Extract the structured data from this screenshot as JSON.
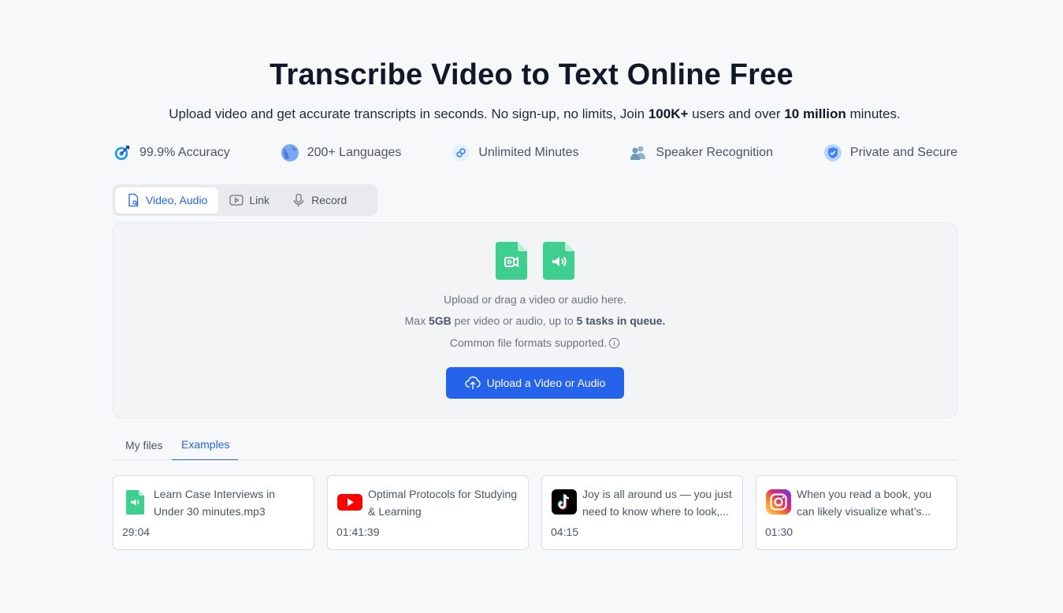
{
  "header": {
    "title": "Transcribe Video to Text Online Free",
    "subtitle_pre": "Upload video and get accurate transcripts in seconds. No sign-up, no limits, Join ",
    "subtitle_b1": "100K+",
    "subtitle_mid": " users and over ",
    "subtitle_b2": "10 million",
    "subtitle_post": " minutes."
  },
  "features": [
    {
      "label": "99.9% Accuracy",
      "icon": "target-icon"
    },
    {
      "label": "200+ Languages",
      "icon": "globe-icon"
    },
    {
      "label": "Unlimited Minutes",
      "icon": "infinity-icon"
    },
    {
      "label": "Speaker Recognition",
      "icon": "users-icon"
    },
    {
      "label": "Private and Secure",
      "icon": "shield-icon"
    }
  ],
  "source_tabs": [
    {
      "label": "Video, Audio",
      "icon": "file-icon",
      "active": true
    },
    {
      "label": "Link",
      "icon": "play-icon",
      "active": false
    },
    {
      "label": "Record",
      "icon": "microphone-icon",
      "active": false
    }
  ],
  "dropzone": {
    "line1": "Upload or drag a video or audio here.",
    "line2_a": "Max ",
    "line2_b": "5GB",
    "line2_c": " per video or audio, up to ",
    "line2_d": "5 tasks in queue.",
    "line3": "Common file formats supported.",
    "button": "Upload a Video or Audio"
  },
  "file_tabs": [
    {
      "label": "My files",
      "active": false
    },
    {
      "label": "Examples",
      "active": true
    }
  ],
  "examples": [
    {
      "title": "Learn Case Interviews in Under 30 minutes.mp3",
      "duration": "29:04",
      "icon": "audio-file-icon"
    },
    {
      "title": "Optimal Protocols for Studying & Learning",
      "duration": "01:41:39",
      "icon": "youtube-icon"
    },
    {
      "title": "Joy is all around us — you just need to know where to look,...",
      "duration": "04:15",
      "icon": "tiktok-icon"
    },
    {
      "title": "When you read a book, you can likely visualize what’s...",
      "duration": "01:30",
      "icon": "instagram-icon"
    }
  ],
  "colors": {
    "accent": "#2563eb",
    "file_green": "#3ecf8e",
    "background": "#f7f8fa"
  }
}
